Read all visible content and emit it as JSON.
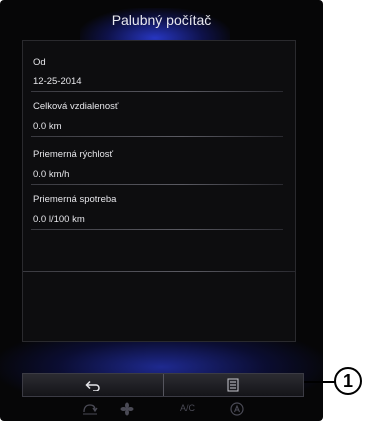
{
  "screen": {
    "title": "Palubný počítač"
  },
  "trip_computer": {
    "rows": [
      {
        "label": "Od",
        "value": "12-25-2014"
      },
      {
        "label": "Celková vzdialenosť",
        "value": "0.0 km"
      },
      {
        "label": "Priemerná rýchlosť",
        "value": "0.0 km/h"
      },
      {
        "label": "Priemerná spotreba",
        "value": "0.0 l/100 km"
      }
    ]
  },
  "bottom_bar": {
    "back_icon": "back-arrow-icon",
    "menu_icon": "menu-list-icon"
  },
  "climate_bar": {
    "ac_label": "A/C",
    "icons": [
      "recirculation-icon",
      "fan-icon",
      "auto-climate-icon"
    ]
  },
  "callout": {
    "label": "1"
  },
  "colors": {
    "background": "#060607",
    "glow": "#3246ff",
    "text": "#e6e6ea",
    "callout": "#000000"
  }
}
